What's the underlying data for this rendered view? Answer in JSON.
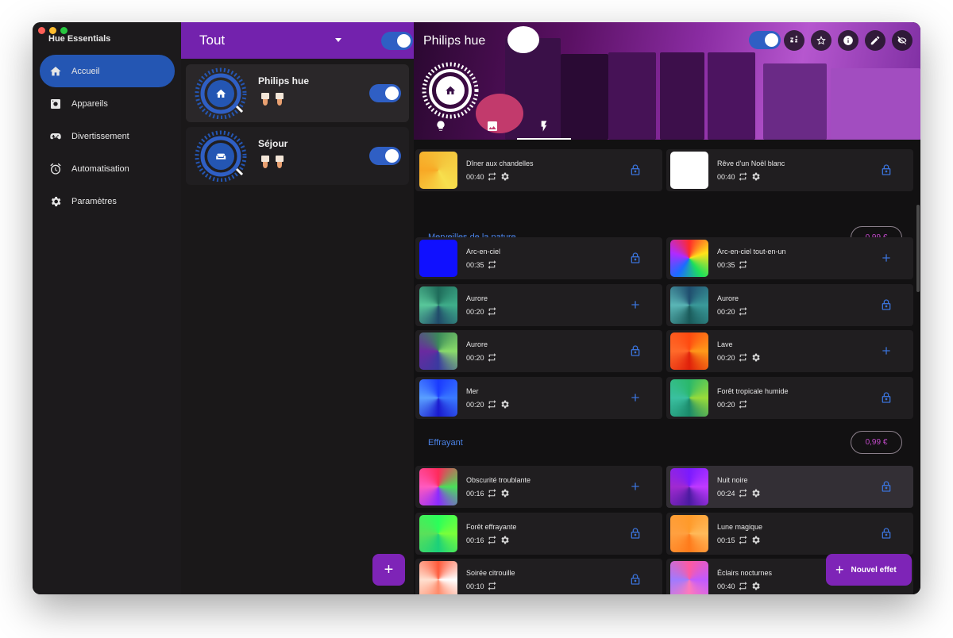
{
  "app": {
    "title": "Hue Essentials"
  },
  "colors": {
    "accent": "#2456b3",
    "purple": "#7e24b7",
    "price": "#c34acb",
    "section": "#4a82e6"
  },
  "sidebar": {
    "items": [
      {
        "label": "Accueil",
        "icon": "home-icon",
        "active": true
      },
      {
        "label": "Appareils",
        "icon": "device-icon",
        "active": false
      },
      {
        "label": "Divertissement",
        "icon": "gamepad-icon",
        "active": false
      },
      {
        "label": "Automatisation",
        "icon": "alarm-icon",
        "active": false
      },
      {
        "label": "Paramètres",
        "icon": "gear-icon",
        "active": false
      }
    ]
  },
  "rooms": {
    "filter": "Tout",
    "all_on": true,
    "list": [
      {
        "name": "Philips hue",
        "icon": "home-icon",
        "on": true
      },
      {
        "name": "Séjour",
        "icon": "sofa-icon",
        "on": true
      }
    ],
    "add_label": "+"
  },
  "main": {
    "title": "Philips hue",
    "on": true,
    "header_icons": [
      "sleep-icon",
      "star-icon",
      "info-icon",
      "edit-icon",
      "hide-icon"
    ],
    "tabs": [
      "bulb-icon",
      "image-icon",
      "bolt-icon"
    ],
    "top_row": [
      {
        "name": "Dîner aux chandelles",
        "duration": "00:40",
        "loop": true,
        "settings": true,
        "action": "lock",
        "colors": [
          "#f4c63d",
          "#f7e04e",
          "#f8a825"
        ]
      },
      {
        "name": "Rêve d'un Noël blanc",
        "duration": "00:40",
        "loop": true,
        "settings": true,
        "action": "lock",
        "colors": [
          "#ffffff",
          "#f5f5f5",
          "#eeeeee"
        ]
      }
    ],
    "sections": [
      {
        "title": "Merveilles de la nature",
        "price": "0,99 €",
        "effects": [
          {
            "name": "Arc-en-ciel",
            "duration": "00:35",
            "loop": true,
            "settings": false,
            "action": "lock",
            "colors": [
              "#1010ff",
              "#0a0ae6",
              "#1a1aff"
            ]
          },
          {
            "name": "Arc-en-ciel tout-en-un",
            "duration": "00:35",
            "loop": true,
            "settings": false,
            "action": "add",
            "colors": [
              "#ff2a2a",
              "#ffe21a",
              "#1ee05a",
              "#1a6cff",
              "#b02aff"
            ]
          },
          {
            "name": "Aurore",
            "duration": "00:20",
            "loop": true,
            "settings": false,
            "action": "add",
            "colors": [
              "#1e6b5a",
              "#3fae8a",
              "#204a6a",
              "#58c79a"
            ]
          },
          {
            "name": "Aurore",
            "duration": "00:20",
            "loop": true,
            "settings": false,
            "action": "lock",
            "colors": [
              "#1f4d6e",
              "#3a9a9a",
              "#1a5a5a",
              "#5ab6b6"
            ]
          },
          {
            "name": "Aurore",
            "duration": "00:20",
            "loop": true,
            "settings": false,
            "action": "lock",
            "colors": [
              "#3b8a5a",
              "#8adc6a",
              "#3a3aa0",
              "#6a2aa0"
            ]
          },
          {
            "name": "Lave",
            "duration": "00:20",
            "loop": true,
            "settings": true,
            "action": "add",
            "colors": [
              "#ff4a10",
              "#ff9a1a",
              "#e0200a",
              "#ff6a2a"
            ]
          },
          {
            "name": "Mer",
            "duration": "00:20",
            "loop": true,
            "settings": true,
            "action": "add",
            "colors": [
              "#1a3aff",
              "#3a7aff",
              "#1a1ad0",
              "#5aa0ff"
            ]
          },
          {
            "name": "Forêt tropicale humide",
            "duration": "00:20",
            "loop": true,
            "settings": false,
            "action": "lock",
            "colors": [
              "#2ab86a",
              "#9adc3a",
              "#1a8a6a",
              "#3ac0a0"
            ]
          }
        ]
      },
      {
        "title": "Effrayant",
        "price": "0,99 €",
        "effects": [
          {
            "name": "Obscurité troublante",
            "duration": "00:16",
            "loop": true,
            "settings": true,
            "action": "add",
            "colors": [
              "#ff2a5a",
              "#4ae05a",
              "#8a2aff",
              "#ff5ac0"
            ]
          },
          {
            "name": "Nuit noire",
            "duration": "00:24",
            "loop": true,
            "settings": true,
            "action": "lock",
            "colors": [
              "#7a1aff",
              "#c03aff",
              "#4a1aa0",
              "#a02ad0"
            ]
          },
          {
            "name": "Forêt effrayante",
            "duration": "00:16",
            "loop": true,
            "settings": true,
            "action": "lock",
            "colors": [
              "#2aff5a",
              "#7aff3a",
              "#1ad07a",
              "#5ae05a"
            ]
          },
          {
            "name": "Lune magique",
            "duration": "00:15",
            "loop": true,
            "settings": true,
            "action": "lock",
            "colors": [
              "#ff9a2a",
              "#ffba5a",
              "#ff7a1a",
              "#ffa040"
            ]
          },
          {
            "name": "Soirée citrouille",
            "duration": "00:10",
            "loop": true,
            "settings": false,
            "action": "lock",
            "colors": [
              "#ff5a3a",
              "#ffffff",
              "#ff8a6a",
              "#ffe0d0"
            ]
          },
          {
            "name": "Éclairs nocturnes",
            "duration": "00:40",
            "loop": true,
            "settings": true,
            "action": "lock",
            "colors": [
              "#ff5aa0",
              "#c05aff",
              "#ff7aba",
              "#a07aff"
            ]
          }
        ]
      }
    ],
    "new_effect_label": "Nouvel effet"
  }
}
